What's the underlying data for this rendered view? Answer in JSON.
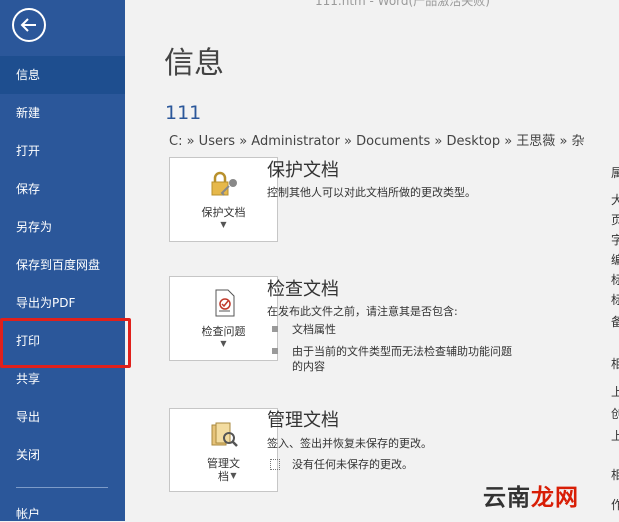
{
  "window_title": "111.htm - Word(产品激活失败)",
  "sidebar": {
    "items": [
      {
        "label": "信息",
        "active": true
      },
      {
        "label": "新建"
      },
      {
        "label": "打开"
      },
      {
        "label": "保存"
      },
      {
        "label": "另存为"
      },
      {
        "label": "保存到百度网盘"
      },
      {
        "label": "导出为PDF"
      },
      {
        "label": "打印"
      },
      {
        "label": "共享"
      },
      {
        "label": "导出"
      },
      {
        "label": "关闭"
      }
    ],
    "account": "帐户"
  },
  "main": {
    "title": "信息",
    "doc_name": "111",
    "path": "C: » Users » Administrator » Documents » Desktop » 王思薇 » 杂",
    "sections": [
      {
        "button_label": "保护文档",
        "title": "保护文档",
        "description": "控制其他人可以对此文档所做的更改类型。"
      },
      {
        "button_label": "检查问题",
        "title": "检查文档",
        "description": "在发布此文件之前，请注意其是否包含:",
        "bullets": [
          "文档属性",
          "由于当前的文件类型而无法检查辅助功能问题",
          "的内容"
        ]
      },
      {
        "button_label_line1": "管理文",
        "button_label_line2": "档",
        "title": "管理文档",
        "description": "签入、签出并恢复未保存的更改。",
        "note": "没有任何未保存的更改。"
      }
    ]
  },
  "right_column_chars": [
    "属",
    "大",
    "页",
    "字",
    "编",
    "标",
    "标",
    "备",
    "相",
    "上",
    "创",
    "上",
    "相",
    "作"
  ],
  "watermark": {
    "part1": "云南",
    "part2": "龙网"
  },
  "colors": {
    "sidebar": "#2b579a",
    "highlight": "#e0201b",
    "accent": "#2b579a"
  }
}
